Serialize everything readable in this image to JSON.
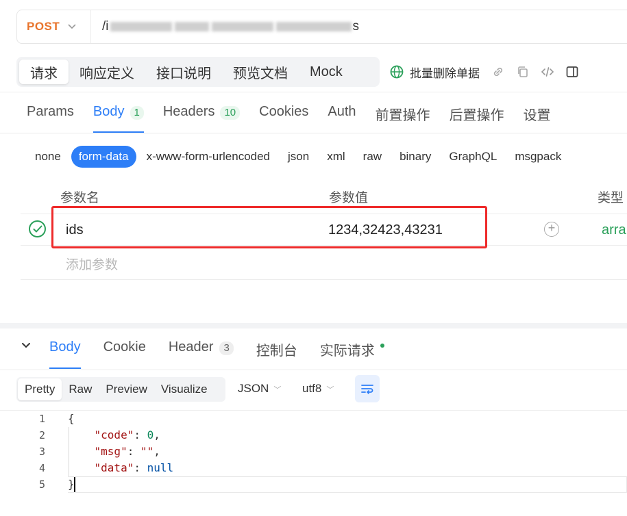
{
  "request": {
    "method": "POST",
    "url_visible_prefix": "/i",
    "url_visible_suffix": "s"
  },
  "top_tabs": [
    "请求",
    "响应定义",
    "接口说明",
    "预览文档",
    "Mock"
  ],
  "toolbar": {
    "batch_delete_label": "批量删除单据"
  },
  "request_tabs": [
    {
      "label": "Params",
      "count": ""
    },
    {
      "label": "Body",
      "count": "1"
    },
    {
      "label": "Headers",
      "count": "10"
    },
    {
      "label": "Cookies",
      "count": ""
    },
    {
      "label": "Auth",
      "count": ""
    },
    {
      "label": "前置操作",
      "count": ""
    },
    {
      "label": "后置操作",
      "count": ""
    },
    {
      "label": "设置",
      "count": ""
    }
  ],
  "body_types": [
    "none",
    "form-data",
    "x-www-form-urlencoded",
    "json",
    "xml",
    "raw",
    "binary",
    "GraphQL",
    "msgpack"
  ],
  "params_table": {
    "headers": {
      "name": "参数名",
      "value": "参数值",
      "type": "类型"
    },
    "rows": [
      {
        "name": "ids",
        "value": "1234,32423,43231",
        "type": "arra"
      }
    ],
    "add_placeholder": "添加参数"
  },
  "response_tabs": [
    {
      "label": "Body",
      "count": ""
    },
    {
      "label": "Cookie",
      "count": ""
    },
    {
      "label": "Header",
      "count": "3"
    },
    {
      "label": "控制台",
      "count": ""
    },
    {
      "label": "实际请求",
      "count": ""
    }
  ],
  "format_tabs": [
    "Pretty",
    "Raw",
    "Preview",
    "Visualize"
  ],
  "format_select": "JSON",
  "encoding_select": "utf8",
  "code_lines": [
    {
      "n": "1",
      "text": "{"
    },
    {
      "n": "2",
      "key": "\"code\"",
      "sep": ": ",
      "val": "0",
      "tail": ","
    },
    {
      "n": "3",
      "key": "\"msg\"",
      "sep": ": ",
      "val": "\"\"",
      "tail": ","
    },
    {
      "n": "4",
      "key": "\"data\"",
      "sep": ": ",
      "val": "null",
      "tail": ""
    },
    {
      "n": "5",
      "text": "}"
    }
  ],
  "colors": {
    "accent": "#2d7ef7",
    "method": "#e8742c",
    "success": "#2ba05a",
    "highlight": "#ee2b2b"
  }
}
